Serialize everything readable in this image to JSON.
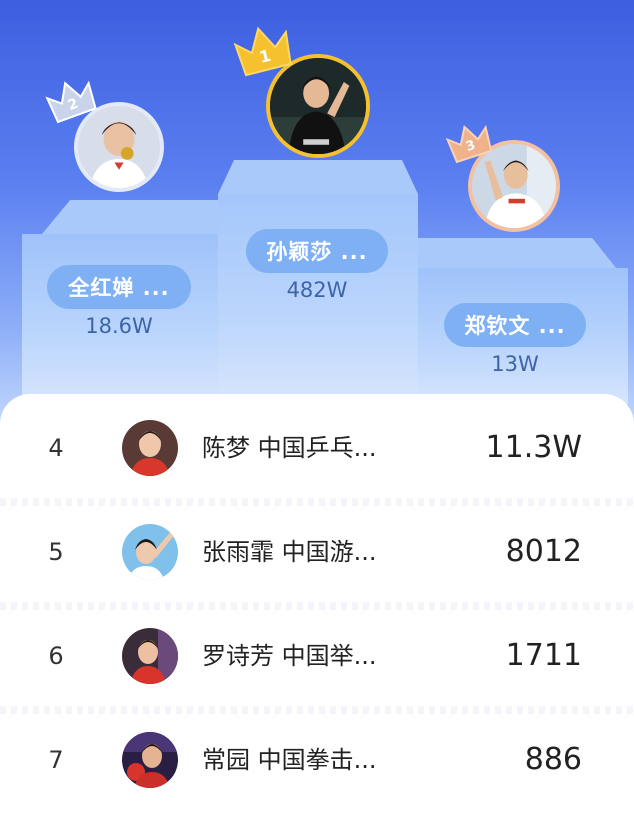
{
  "podium": [
    {
      "rank": "2",
      "name": "全红婵 ...",
      "score": "18.6W",
      "crown_color": "#c9d3ea"
    },
    {
      "rank": "1",
      "name": "孙颖莎 ...",
      "score": "482W",
      "crown_color": "#f6c12f"
    },
    {
      "rank": "3",
      "name": "郑钦文 ...",
      "score": "13W",
      "crown_color": "#f0b28a"
    }
  ],
  "list": [
    {
      "rank": "4",
      "name": "陈梦 中国乒乓...",
      "score": "11.3W"
    },
    {
      "rank": "5",
      "name": "张雨霏 中国游...",
      "score": "8012"
    },
    {
      "rank": "6",
      "name": "罗诗芳 中国举...",
      "score": "1711"
    },
    {
      "rank": "7",
      "name": "常园 中国拳击...",
      "score": "886"
    }
  ],
  "colors": {
    "accent": "#5a7ff0",
    "pill": "#7fb0f3",
    "gold": "#f6c12f",
    "silver": "#c9d3ea",
    "bronze": "#f0b28a"
  }
}
